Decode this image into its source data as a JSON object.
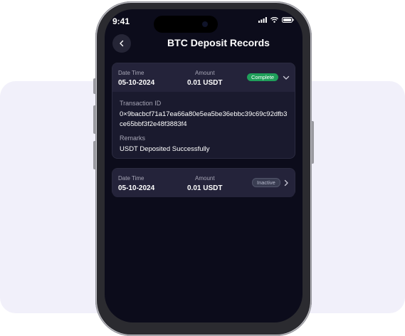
{
  "status_bar": {
    "time": "9:41"
  },
  "header": {
    "title": "BTC Deposit Records"
  },
  "records": [
    {
      "date_label": "Date Time",
      "date": "05-10-2024",
      "amount_label": "Amount",
      "amount": "0.01 USDT",
      "status": "Complete",
      "transaction_label": "Transaction ID",
      "transaction_id": "0×9bacbcf71a17ea66a80e5ea5be36ebbc39c69c92dfb3ce65bbf3f2e48f3883f4",
      "remarks_label": "Remarks",
      "remarks": "USDT Deposited Successfully",
      "expanded": true
    },
    {
      "date_label": "Date Time",
      "date": "05-10-2024",
      "amount_label": "Amount",
      "amount": "0.01 USDT",
      "status": "Inactive",
      "expanded": false
    }
  ],
  "colors": {
    "screen_bg": "#0c0c1b",
    "card_bg": "#1a1a2e",
    "complete": "#1f9f5a",
    "inactive": "#3a3d52"
  },
  "icons": [
    "back-arrow-icon",
    "chevron-down-icon",
    "chevron-right-icon",
    "signal-icon",
    "wifi-icon",
    "battery-icon"
  ]
}
